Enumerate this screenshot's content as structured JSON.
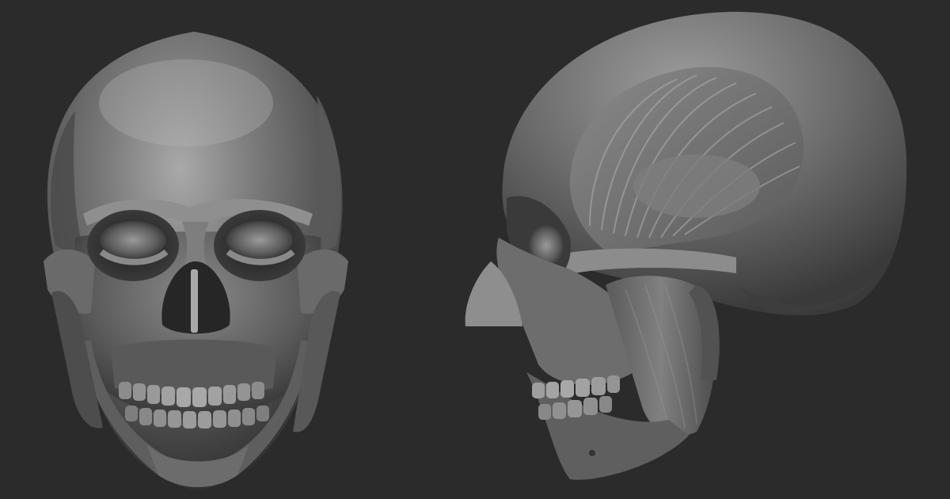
{
  "scene": {
    "background_color": "#2b2b2b",
    "material_colors": {
      "bone_base": "#6f6f6f",
      "bone_highlight": "#b9b9b9",
      "bone_shadow": "#2e2e2e",
      "nasal_cartilage": "#8e8e8e"
    },
    "views": [
      {
        "name": "front-view",
        "subject": "skull-front"
      },
      {
        "name": "side-view",
        "subject": "skull-side"
      }
    ]
  }
}
